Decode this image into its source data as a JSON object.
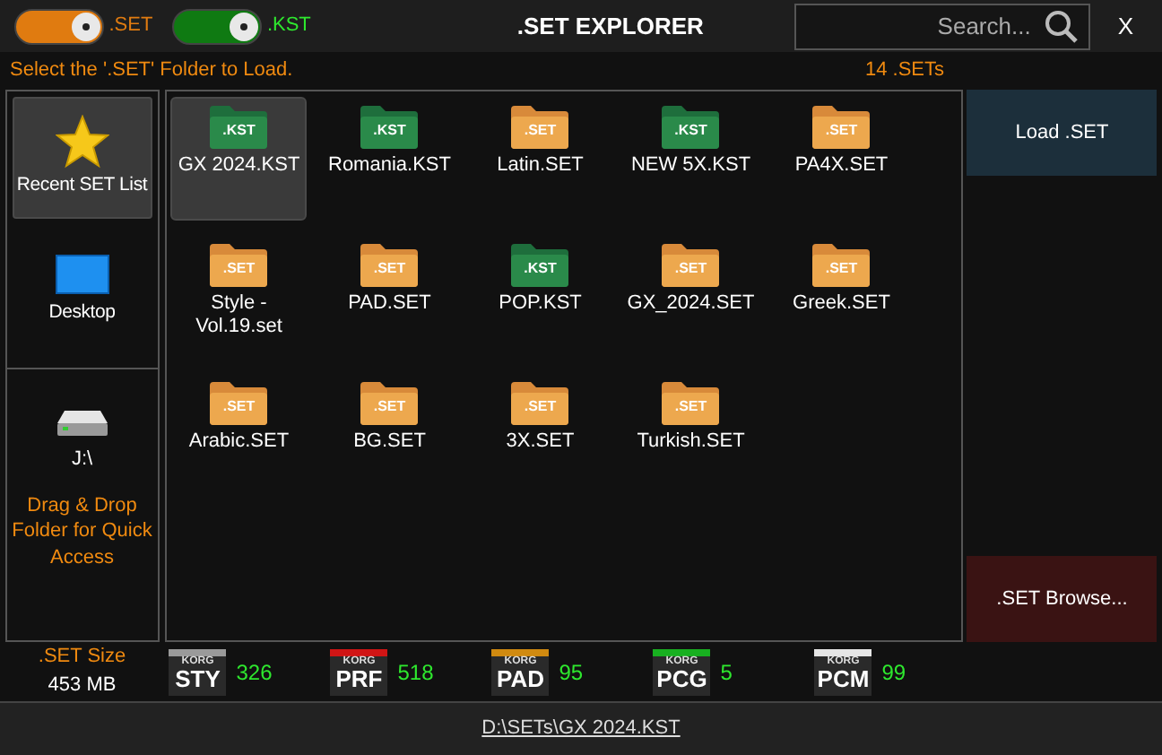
{
  "toggles": [
    {
      "label": ".SET",
      "on": true,
      "color": "#e07b10"
    },
    {
      "label": ".KST",
      "on": true,
      "color": "#0f7a12"
    }
  ],
  "window": {
    "title": ".SET EXPLORER",
    "close": "X"
  },
  "search": {
    "placeholder": "Search..."
  },
  "hint": "Select the '.SET' Folder to  Load.",
  "count": "14 .SETs",
  "sidebar": {
    "items": [
      {
        "label": "Recent SET List",
        "kind": "star",
        "selected": true
      },
      {
        "label": "Desktop",
        "kind": "monitor",
        "selected": false
      }
    ],
    "drive": {
      "label": "J:\\"
    },
    "drop_hint": "Drag & Drop Folder for Quick Access"
  },
  "files": [
    {
      "name": "GX 2024.KST",
      "tag": ".KST",
      "kind": "kst",
      "selected": true
    },
    {
      "name": "Romania.KST",
      "tag": ".KST",
      "kind": "kst",
      "selected": false
    },
    {
      "name": "Latin.SET",
      "tag": ".SET",
      "kind": "set",
      "selected": false
    },
    {
      "name": "NEW 5X.KST",
      "tag": ".KST",
      "kind": "kst",
      "selected": false
    },
    {
      "name": "PA4X.SET",
      "tag": ".SET",
      "kind": "set",
      "selected": false
    },
    {
      "name": "Style - Vol.19.set",
      "tag": ".SET",
      "kind": "set",
      "selected": false
    },
    {
      "name": "PAD.SET",
      "tag": ".SET",
      "kind": "set",
      "selected": false
    },
    {
      "name": "POP.KST",
      "tag": ".KST",
      "kind": "kst",
      "selected": false
    },
    {
      "name": "GX_2024.SET",
      "tag": ".SET",
      "kind": "set",
      "selected": false
    },
    {
      "name": "Greek.SET",
      "tag": ".SET",
      "kind": "set",
      "selected": false
    },
    {
      "name": "Arabic.SET",
      "tag": ".SET",
      "kind": "set",
      "selected": false
    },
    {
      "name": "BG.SET",
      "tag": ".SET",
      "kind": "set",
      "selected": false
    },
    {
      "name": "3X.SET",
      "tag": ".SET",
      "kind": "set",
      "selected": false
    },
    {
      "name": "Turkish.SET",
      "tag": ".SET",
      "kind": "set",
      "selected": false
    }
  ],
  "buttons": {
    "load": "Load .SET",
    "browse": ".SET Browse..."
  },
  "size": {
    "label": ".SET Size",
    "value": "453 MB"
  },
  "stats": [
    {
      "brand": "KORG",
      "type": "STY",
      "count": "326",
      "color": "#9a9a9a"
    },
    {
      "brand": "KORG",
      "type": "PRF",
      "count": "518",
      "color": "#d01515"
    },
    {
      "brand": "KORG",
      "type": "PAD",
      "count": "95",
      "color": "#d08a10"
    },
    {
      "brand": "KORG",
      "type": "PCG",
      "count": "5",
      "color": "#18b020"
    },
    {
      "brand": "KORG",
      "type": "PCM",
      "count": "99",
      "color": "#e6e6e6"
    }
  ],
  "status_bar": {
    "path": "D:\\SETs\\GX 2024.KST"
  }
}
